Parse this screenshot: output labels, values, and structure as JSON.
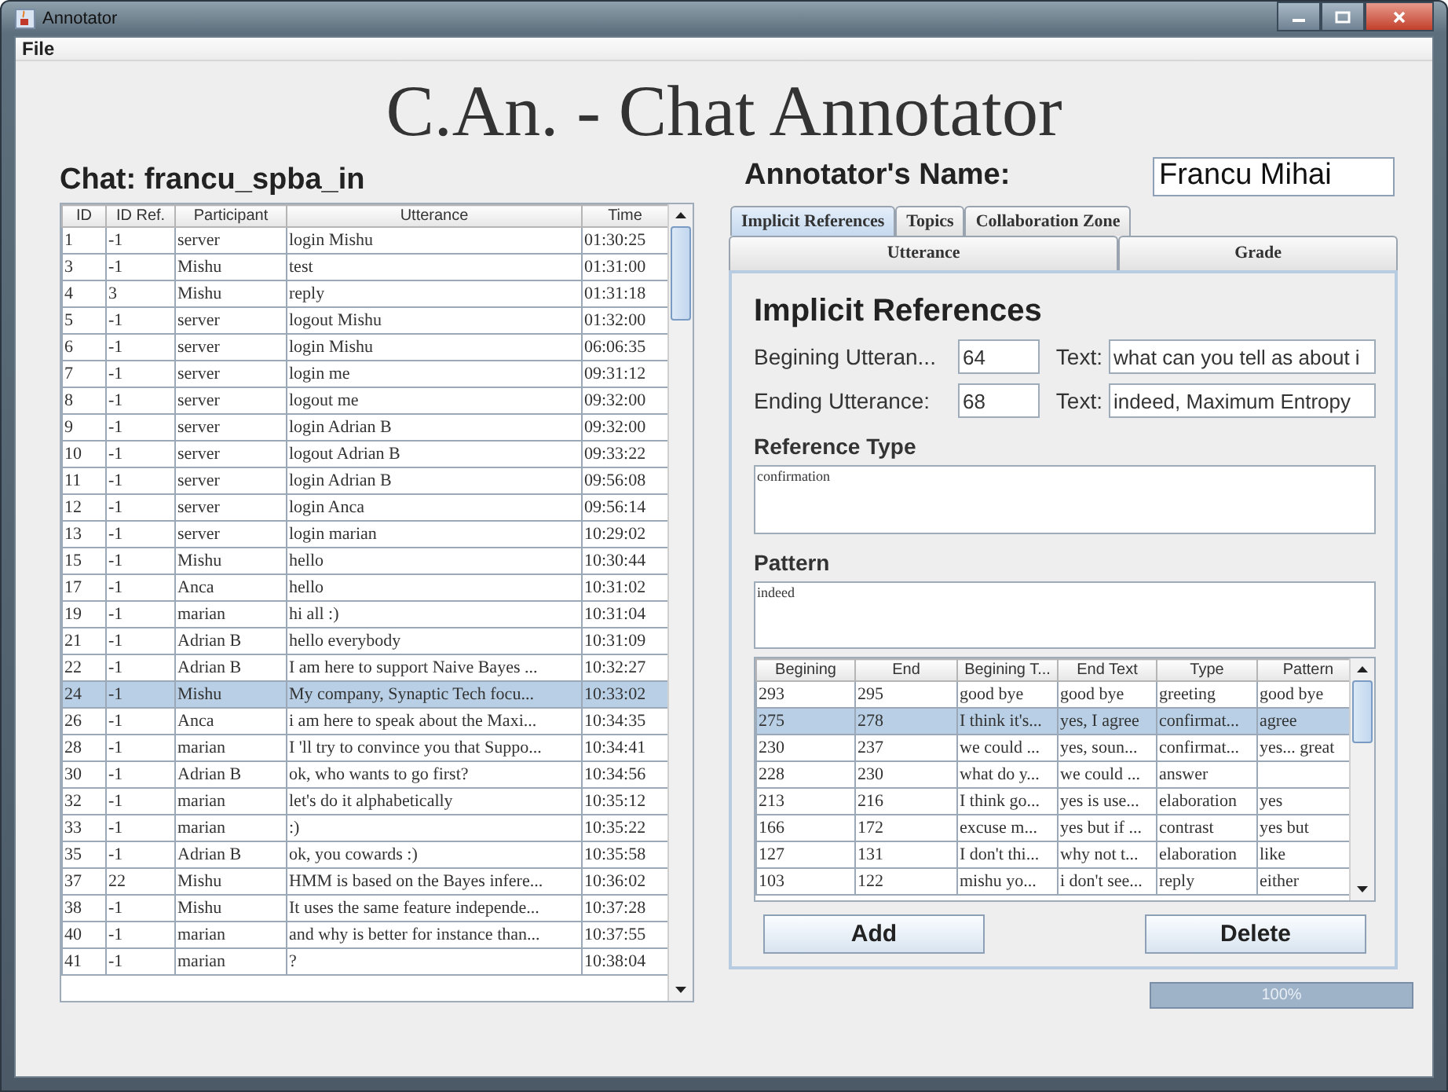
{
  "window": {
    "title": "Annotator"
  },
  "menu": [
    {
      "label": "File"
    }
  ],
  "app_title": "C.An. - Chat Annotator",
  "chat": {
    "title": "Chat: francu_spba_in",
    "columns": [
      "ID",
      "ID Ref.",
      "Participant",
      "Utterance",
      "Time"
    ],
    "rows": [
      {
        "cells": [
          "1",
          "-1",
          "server",
          "login Mishu",
          "01:30:25"
        ],
        "selected": false
      },
      {
        "cells": [
          "3",
          "-1",
          "Mishu",
          "test",
          "01:31:00"
        ],
        "selected": false
      },
      {
        "cells": [
          "4",
          "3",
          "Mishu",
          "reply",
          "01:31:18"
        ],
        "selected": false
      },
      {
        "cells": [
          "5",
          "-1",
          "server",
          "logout Mishu",
          "01:32:00"
        ],
        "selected": false
      },
      {
        "cells": [
          "6",
          "-1",
          "server",
          "login Mishu",
          "06:06:35"
        ],
        "selected": false
      },
      {
        "cells": [
          "7",
          "-1",
          "server",
          "login me",
          "09:31:12"
        ],
        "selected": false
      },
      {
        "cells": [
          "8",
          "-1",
          "server",
          "logout me",
          "09:32:00"
        ],
        "selected": false
      },
      {
        "cells": [
          "9",
          "-1",
          "server",
          "login Adrian B",
          "09:32:00"
        ],
        "selected": false
      },
      {
        "cells": [
          "10",
          "-1",
          "server",
          "logout Adrian B",
          "09:33:22"
        ],
        "selected": false
      },
      {
        "cells": [
          "11",
          "-1",
          "server",
          "login Adrian B",
          "09:56:08"
        ],
        "selected": false
      },
      {
        "cells": [
          "12",
          "-1",
          "server",
          "login Anca",
          "09:56:14"
        ],
        "selected": false
      },
      {
        "cells": [
          "13",
          "-1",
          "server",
          "login marian",
          "10:29:02"
        ],
        "selected": false
      },
      {
        "cells": [
          "15",
          "-1",
          "Mishu",
          "hello",
          "10:30:44"
        ],
        "selected": false
      },
      {
        "cells": [
          "17",
          "-1",
          "Anca",
          "hello",
          "10:31:02"
        ],
        "selected": false
      },
      {
        "cells": [
          "19",
          "-1",
          "marian",
          "hi all :)",
          "10:31:04"
        ],
        "selected": false
      },
      {
        "cells": [
          "21",
          "-1",
          "Adrian B",
          "hello everybody",
          "10:31:09"
        ],
        "selected": false
      },
      {
        "cells": [
          "22",
          "-1",
          "Adrian B",
          "I am here to support Naive Bayes ...",
          "10:32:27"
        ],
        "selected": false
      },
      {
        "cells": [
          "24",
          "-1",
          "Mishu",
          "My company, Synaptic Tech focu...",
          "10:33:02"
        ],
        "selected": true
      },
      {
        "cells": [
          "26",
          "-1",
          "Anca",
          "i am here to speak about the Maxi...",
          "10:34:35"
        ],
        "selected": false
      },
      {
        "cells": [
          "28",
          "-1",
          "marian",
          "I 'll try to convince you that Suppo...",
          "10:34:41"
        ],
        "selected": false
      },
      {
        "cells": [
          "30",
          "-1",
          "Adrian B",
          "ok, who wants to go first?",
          "10:34:56"
        ],
        "selected": false
      },
      {
        "cells": [
          "32",
          "-1",
          "marian",
          "let's do it alphabetically",
          "10:35:12"
        ],
        "selected": false
      },
      {
        "cells": [
          "33",
          "-1",
          "marian",
          ":)",
          "10:35:22"
        ],
        "selected": false
      },
      {
        "cells": [
          "35",
          "-1",
          "Adrian B",
          "ok, you cowards :)",
          "10:35:58"
        ],
        "selected": false
      },
      {
        "cells": [
          "37",
          "22",
          "Mishu",
          "HMM is based on the Bayes infere...",
          "10:36:02"
        ],
        "selected": false
      },
      {
        "cells": [
          "38",
          "-1",
          "Mishu",
          "It uses the same feature independe...",
          "10:37:28"
        ],
        "selected": false
      },
      {
        "cells": [
          "40",
          "-1",
          "marian",
          "and why is better for instance than...",
          "10:37:55"
        ],
        "selected": false
      },
      {
        "cells": [
          "41",
          "-1",
          "marian",
          "?",
          "10:38:04"
        ],
        "selected": false
      }
    ]
  },
  "annotator": {
    "label": "Annotator's Name:",
    "value": "Francu Mihai"
  },
  "tabs": {
    "upper": [
      {
        "label": "Implicit References",
        "selected": true
      },
      {
        "label": "Topics",
        "selected": false
      },
      {
        "label": "Collaboration Zone",
        "selected": false
      }
    ],
    "lower": [
      {
        "label": "Utterance",
        "selected": false
      },
      {
        "label": "Grade",
        "selected": false
      }
    ]
  },
  "panel": {
    "heading": "Implicit References",
    "fields": [
      {
        "label": "Begining Utteran...",
        "value": "64",
        "text_label": "Text:",
        "text_value": "what can you tell as about i"
      },
      {
        "label": "Ending Utterance:",
        "value": "68",
        "text_label": "Text:",
        "text_value": "indeed, Maximum Entropy"
      }
    ],
    "reference_type": {
      "label": "Reference Type",
      "value": "confirmation"
    },
    "pattern": {
      "label": "Pattern",
      "value": "indeed"
    },
    "table": {
      "columns": [
        "Begining",
        "End",
        "Begining T...",
        "End Text",
        "Type",
        "Pattern"
      ],
      "rows": [
        {
          "cells": [
            "293",
            "295",
            "good bye",
            "good bye",
            "greeting",
            "good bye"
          ],
          "selected": false
        },
        {
          "cells": [
            "275",
            "278",
            "I think it's...",
            "yes, I agree",
            "confirmat...",
            "agree"
          ],
          "selected": true
        },
        {
          "cells": [
            "230",
            "237",
            "we could ...",
            "yes, soun...",
            "confirmat...",
            "yes... great"
          ],
          "selected": false
        },
        {
          "cells": [
            "228",
            "230",
            "what do y...",
            "we could ...",
            "answer",
            ""
          ],
          "selected": false
        },
        {
          "cells": [
            "213",
            "216",
            "I think go...",
            "yes is use...",
            "elaboration",
            "yes"
          ],
          "selected": false
        },
        {
          "cells": [
            "166",
            "172",
            "excuse m...",
            "yes but if ...",
            "contrast",
            "yes but"
          ],
          "selected": false
        },
        {
          "cells": [
            "127",
            "131",
            "I don't thi...",
            "why not t...",
            "elaboration",
            "like"
          ],
          "selected": false
        },
        {
          "cells": [
            "103",
            "122",
            "mishu yo...",
            "i don't see...",
            "reply",
            "either"
          ],
          "selected": false
        }
      ]
    },
    "buttons": [
      "Add",
      "Delete"
    ]
  },
  "progress": {
    "level": 1,
    "text": "100%"
  }
}
